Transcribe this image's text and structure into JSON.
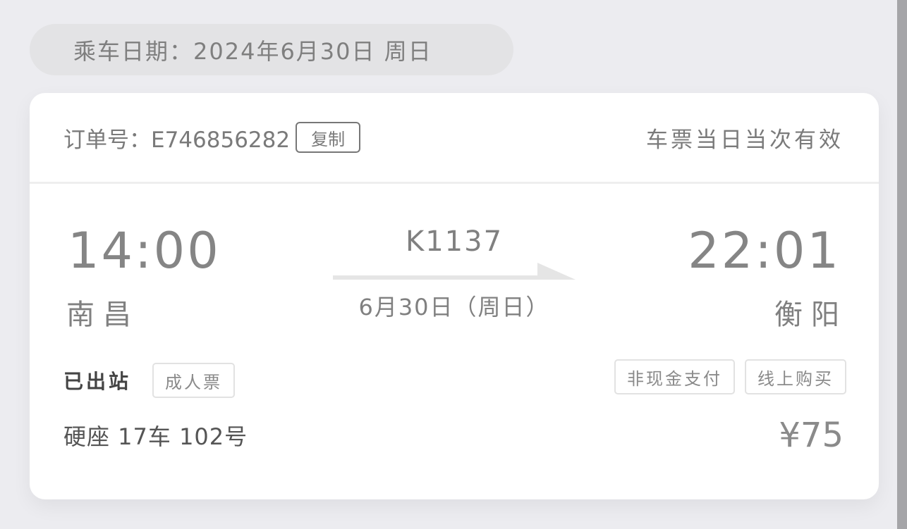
{
  "header": {
    "travel_date_label": "乘车日期：2024年6月30日 周日"
  },
  "order": {
    "order_label": "订单号：E746856282",
    "copy_button": "复制",
    "validity_note": "车票当日当次有效"
  },
  "trip": {
    "departure_time": "14:00",
    "departure_station": "南昌",
    "train_number": "K1137",
    "run_date": "6月30日（周日）",
    "arrival_time": "22:01",
    "arrival_station": "衡阳"
  },
  "ticket": {
    "status": "已出站",
    "ticket_type": "成人票",
    "payment_tags": [
      "非现金支付",
      "线上购买"
    ],
    "seat": "硬座 17车 102号",
    "price": "¥75"
  },
  "colors": {
    "background": "#ececf0",
    "card": "#ffffff",
    "text_gray": "#808080",
    "arrow": "#e5e5e5"
  }
}
